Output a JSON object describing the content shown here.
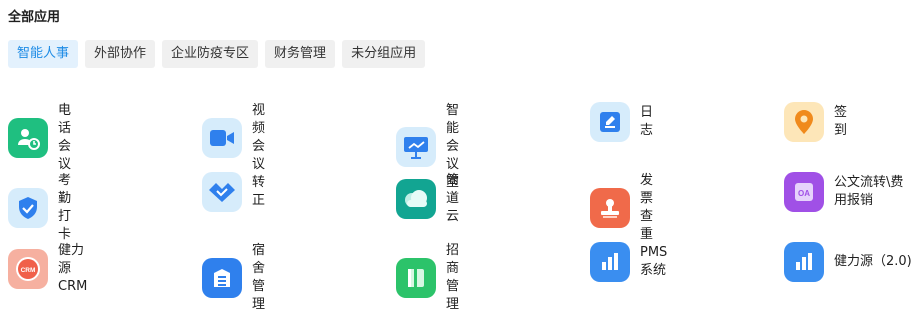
{
  "section_title": "全部应用",
  "tabs": [
    {
      "label": "智能人事",
      "active": true
    },
    {
      "label": "外部协作",
      "active": false
    },
    {
      "label": "企业防疫专区",
      "active": false
    },
    {
      "label": "财务管理",
      "active": false
    },
    {
      "label": "未分组应用",
      "active": false
    }
  ],
  "apps": [
    {
      "label": "电话会议",
      "icon": "phone-meeting-icon",
      "color": "#1fbf80"
    },
    {
      "label": "视频会议",
      "icon": "video-camera-icon",
      "color": "#d6ecfb"
    },
    {
      "label": "智能会议室",
      "icon": "presentation-board-icon",
      "color": "#d6ecfb"
    },
    {
      "label": "日志",
      "icon": "journal-edit-icon",
      "color": "#d6ecfb"
    },
    {
      "label": "签到",
      "icon": "location-pin-icon",
      "color": "#fde6b8"
    },
    {
      "label": "考勤打卡",
      "icon": "check-shield-icon",
      "color": "#d6ecfb"
    },
    {
      "label": "转正",
      "icon": "heart-check-icon",
      "color": "#d6ecfb"
    },
    {
      "label": "简道云",
      "icon": "cloud-icon",
      "color": "#12a592"
    },
    {
      "label": "发票查重",
      "icon": "stamp-icon",
      "color": "#f06a4a"
    },
    {
      "label": "公文流转\\费用报销",
      "icon": "oa-document-icon",
      "color": "#a050e6"
    },
    {
      "label": "健力源CRM",
      "icon": "crm-badge-icon",
      "color": "#f6b0a0"
    },
    {
      "label": "宿舍管理",
      "icon": "building-icon",
      "color": "#2f80ed"
    },
    {
      "label": "招商管理",
      "icon": "book-icon",
      "color": "#2cc36a"
    },
    {
      "label": "PMS系统",
      "icon": "bar-chart-icon",
      "color": "#3a8ef0"
    },
    {
      "label": "健力源（2.0)",
      "icon": "bar-chart-icon",
      "color": "#3a8ef0"
    }
  ]
}
